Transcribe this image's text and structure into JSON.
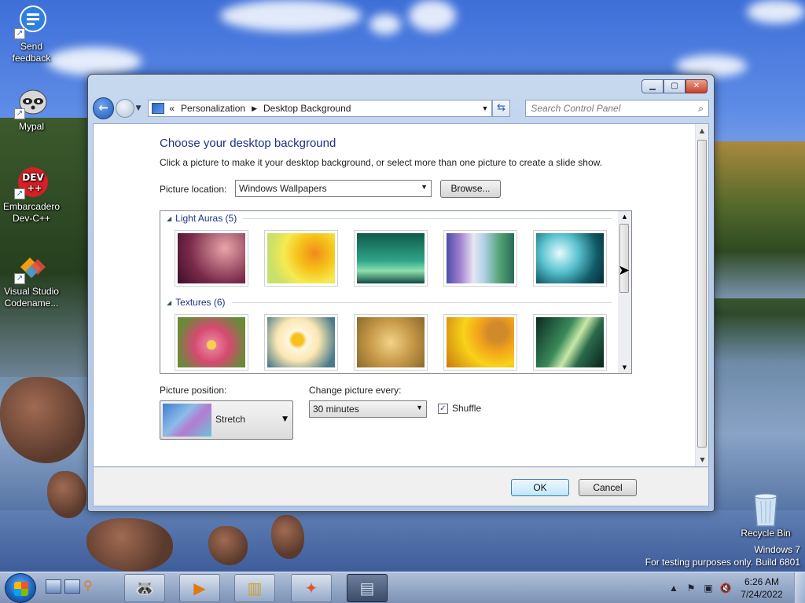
{
  "desktop": {
    "icons": [
      {
        "label": "Send feedback"
      },
      {
        "label": "Mypal"
      },
      {
        "label": "Embarcadero Dev-C++"
      },
      {
        "label": "Visual Studio Codename..."
      },
      {
        "label": "Recycle Bin"
      }
    ],
    "watermark": {
      "line1": "Windows 7",
      "line2": "For testing purposes only. Build 6801"
    }
  },
  "window": {
    "breadcrumb": [
      "Personalization",
      "Desktop Background"
    ],
    "search_placeholder": "Search Control Panel",
    "title": "Choose your desktop background",
    "subtitle": "Click a picture to make it your desktop background, or select more than one picture to create a slide show.",
    "picture_location_label": "Picture location:",
    "picture_location_value": "Windows Wallpapers",
    "browse_label": "Browse...",
    "groups": [
      {
        "name": "Light Auras (5)"
      },
      {
        "name": "Textures (6)"
      }
    ],
    "picture_position_label": "Picture position:",
    "picture_position_value": "Stretch",
    "change_picture_label": "Change picture every:",
    "change_picture_value": "30 minutes",
    "shuffle_label": "Shuffle",
    "shuffle_checked": true,
    "ok_label": "OK",
    "cancel_label": "Cancel"
  },
  "taskbar": {
    "time": "6:26 AM",
    "date": "7/24/2022"
  }
}
